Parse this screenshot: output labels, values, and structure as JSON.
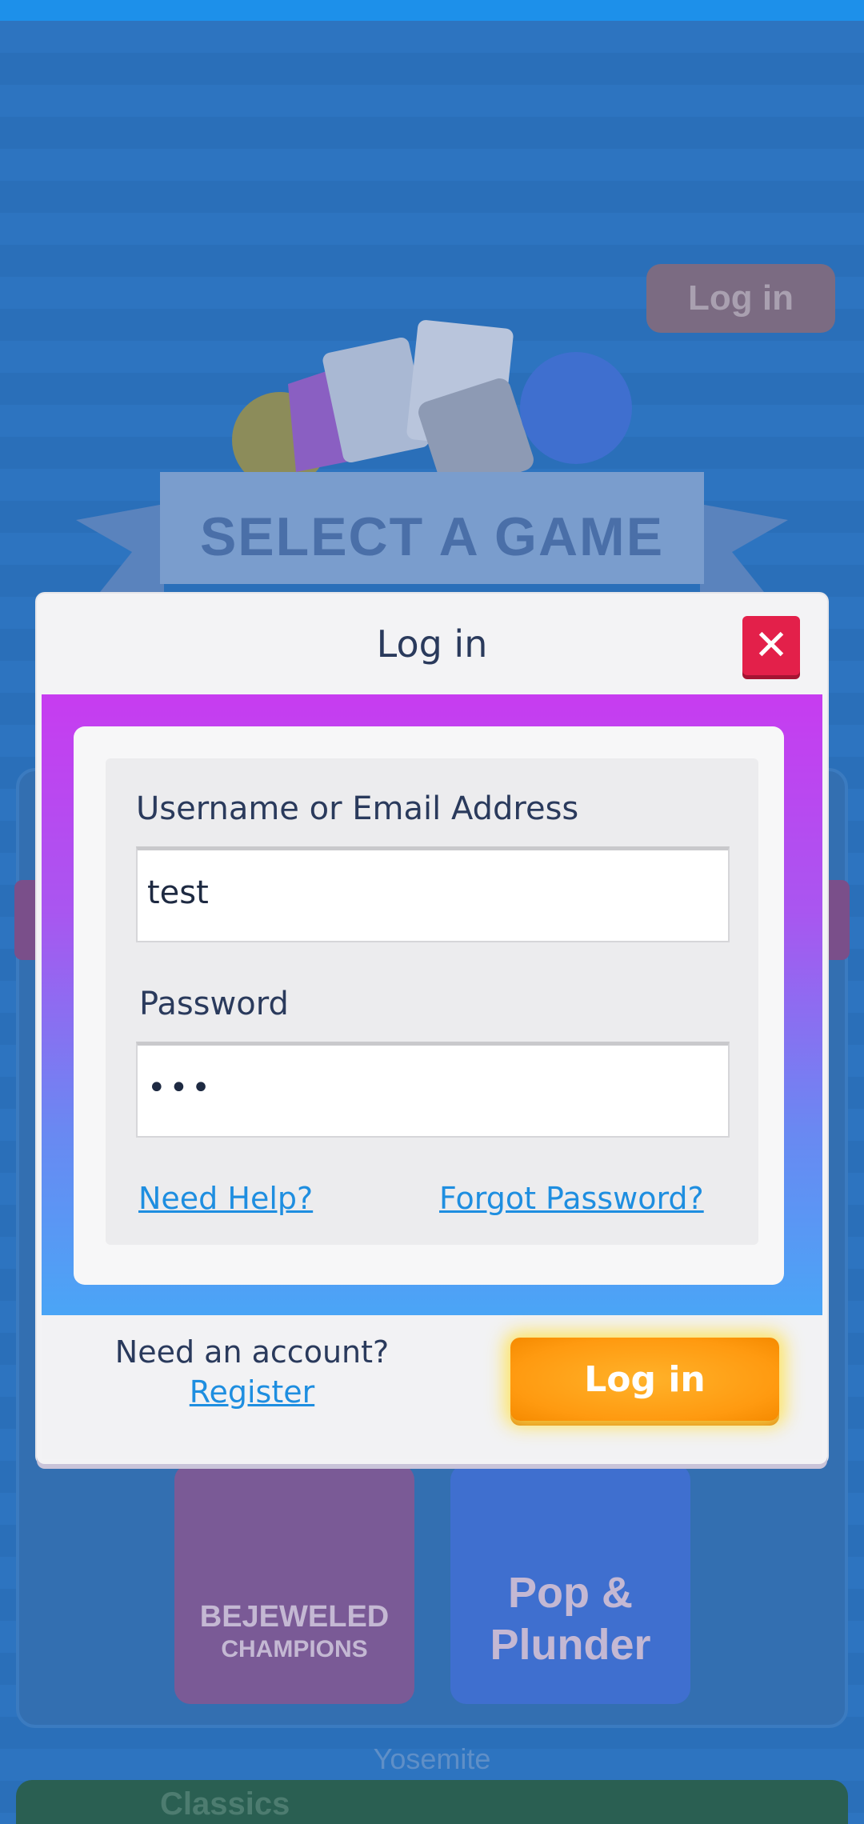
{
  "background": {
    "login_button_label": "Log in",
    "banner_title": "SELECT A GAME",
    "tiles": [
      {
        "line1": "BEJEWELED",
        "line2": "CHAMPIONS"
      },
      {
        "line1": "Pop &",
        "line2": "Plunder"
      }
    ],
    "location_label": "Yosemite",
    "bottom_label": "Classics"
  },
  "modal": {
    "title": "Log in",
    "close_icon": "close-icon",
    "username_label": "Username or Email Address",
    "username_value": "test",
    "password_label": "Password",
    "password_value": "•••",
    "need_help_link": "Need Help?",
    "forgot_password_link": "Forgot Password?",
    "need_account_text": "Need an account?",
    "register_link": "Register",
    "login_button_label": "Log in"
  },
  "colors": {
    "header_close": "#e3204a",
    "gradient_top": "#c73cf0",
    "gradient_bottom": "#4aa5f6",
    "link": "#1e8ee0",
    "login_button": "#ff9a10"
  }
}
